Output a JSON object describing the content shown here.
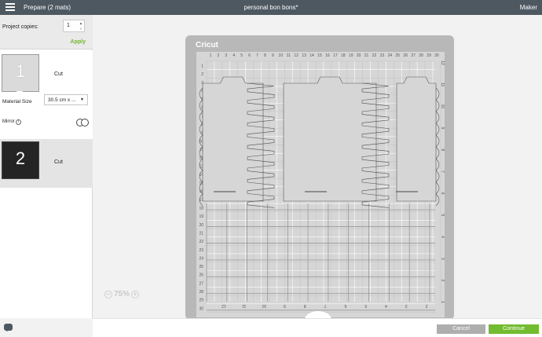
{
  "header": {
    "title": "Prepare (2 mats)",
    "project_name": "personal bon bons*",
    "machine": "Maker"
  },
  "sidebar": {
    "copies_label": "Project copies:",
    "copies_value": "1",
    "apply_label": "Apply",
    "mats": [
      {
        "number": "1",
        "label": "Cut",
        "material_size_label": "Material Size",
        "material_size_value": "30.5 cm x ...",
        "mirror_label": "Mirror"
      },
      {
        "number": "2",
        "label": "Cut"
      }
    ]
  },
  "canvas": {
    "brand": "Cricut",
    "top_ruler": [
      "1",
      "2",
      "3",
      "4",
      "5",
      "6",
      "7",
      "8",
      "9",
      "10",
      "11",
      "12",
      "13",
      "14",
      "15",
      "16",
      "17",
      "18",
      "19",
      "20",
      "21",
      "22",
      "23",
      "24",
      "25",
      "26",
      "27",
      "28",
      "29",
      "30"
    ],
    "left_ruler": [
      "1",
      "2",
      "3",
      "4",
      "5",
      "6",
      "7",
      "8",
      "9",
      "10",
      "11",
      "12",
      "13",
      "14",
      "15",
      "16",
      "17",
      "18",
      "19",
      "20",
      "21",
      "22",
      "23",
      "24",
      "25",
      "26",
      "27",
      "28",
      "29",
      "30"
    ],
    "right_ruler": [
      "12",
      "11",
      "10",
      "9",
      "8",
      "7",
      "6",
      "5",
      "4",
      "3",
      "2",
      "1"
    ],
    "bottom_ruler": [
      "12",
      "11",
      "10",
      "9",
      "8",
      "7",
      "6",
      "5",
      "4",
      "3",
      "2",
      "1"
    ]
  },
  "zoom": {
    "value": "75%",
    "minus": "−",
    "plus": "+"
  },
  "footer": {
    "cancel_label": "Cancel",
    "continue_label": "Continue"
  },
  "colors": {
    "topbar": "#4d5861",
    "accent_green": "#72bc2f",
    "mat_gray": "#b8b8b8"
  },
  "icons": [
    "menu-icon",
    "info-icon",
    "toggle-icon",
    "chat-icon",
    "zoom-minus-icon",
    "zoom-plus-icon",
    "stepper-up-icon",
    "stepper-down-icon",
    "dropdown-caret-icon"
  ]
}
